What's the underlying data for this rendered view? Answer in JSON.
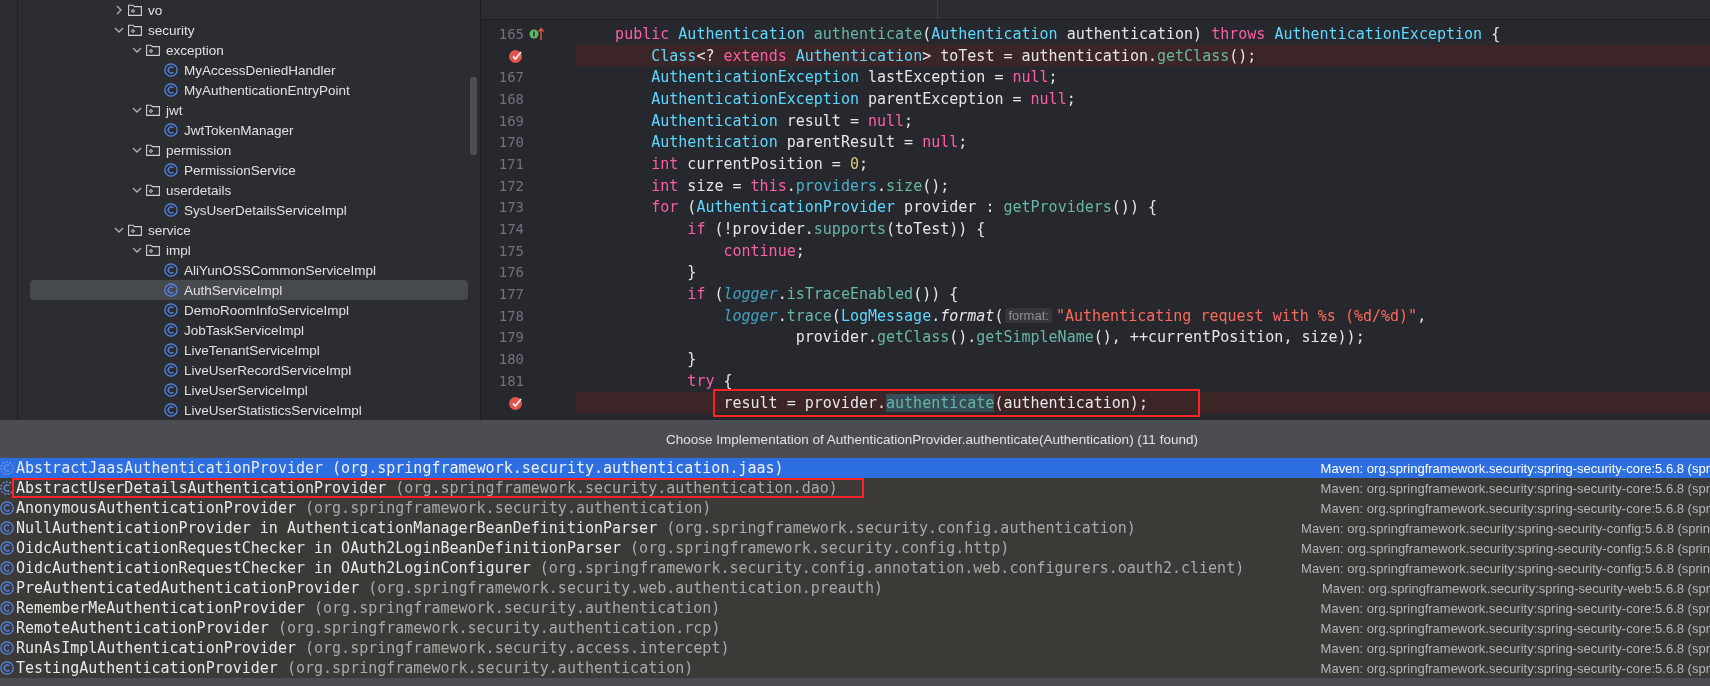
{
  "project_tree": {
    "items": [
      {
        "label": "vo",
        "kind": "folder",
        "expanded": false,
        "selected": false
      },
      {
        "label": "security",
        "kind": "folder",
        "expanded": true,
        "selected": false,
        "children": [
          {
            "label": "exception",
            "kind": "folder",
            "expanded": true,
            "selected": false,
            "children": [
              {
                "label": "MyAccessDeniedHandler",
                "kind": "class",
                "selected": false
              },
              {
                "label": "MyAuthenticationEntryPoint",
                "kind": "class",
                "selected": false
              }
            ]
          },
          {
            "label": "jwt",
            "kind": "folder",
            "expanded": true,
            "selected": false,
            "children": [
              {
                "label": "JwtTokenManager",
                "kind": "class",
                "selected": false
              }
            ]
          },
          {
            "label": "permission",
            "kind": "folder",
            "expanded": true,
            "selected": false,
            "children": [
              {
                "label": "PermissionService",
                "kind": "class",
                "selected": false
              }
            ]
          },
          {
            "label": "userdetails",
            "kind": "folder",
            "expanded": true,
            "selected": false,
            "children": [
              {
                "label": "SysUserDetailsServiceImpl",
                "kind": "class",
                "selected": false
              }
            ]
          }
        ]
      },
      {
        "label": "service",
        "kind": "folder",
        "expanded": true,
        "selected": false,
        "children": [
          {
            "label": "impl",
            "kind": "folder",
            "expanded": true,
            "selected": false,
            "children": [
              {
                "label": "AliYunOSSCommonServiceImpl",
                "kind": "class",
                "selected": false
              },
              {
                "label": "AuthServiceImpl",
                "kind": "class",
                "selected": true
              },
              {
                "label": "DemoRoomInfoServiceImpl",
                "kind": "class",
                "selected": false
              },
              {
                "label": "JobTaskServiceImpl",
                "kind": "class",
                "selected": false
              },
              {
                "label": "LiveTenantServiceImpl",
                "kind": "class",
                "selected": false
              },
              {
                "label": "LiveUserRecordServiceImpl",
                "kind": "class",
                "selected": false
              },
              {
                "label": "LiveUserServiceImpl",
                "kind": "class",
                "selected": false
              },
              {
                "label": "LiveUserStatisticsServiceImpl",
                "kind": "class",
                "selected": false
              }
            ]
          }
        ]
      }
    ]
  },
  "editor": {
    "lines": [
      {
        "number": "165",
        "override": true,
        "breakpoint": false,
        "annotated": false,
        "segments": [
          {
            "text": "    public ",
            "kind": "keyword"
          },
          {
            "text": "Authentication ",
            "kind": "type"
          },
          {
            "text": "authenticate",
            "kind": "function"
          },
          {
            "text": "(",
            "kind": "plain"
          },
          {
            "text": "Authentication",
            "kind": "type"
          },
          {
            "text": " authentication) ",
            "kind": "plain"
          },
          {
            "text": "throws ",
            "kind": "keyword"
          },
          {
            "text": "AuthenticationException",
            "kind": "type"
          },
          {
            "text": " {",
            "kind": "plain"
          }
        ]
      },
      {
        "override": false,
        "breakpoint": true,
        "annotated": false,
        "segments": [
          {
            "text": "        Class",
            "kind": "type"
          },
          {
            "text": "<? ",
            "kind": "plain"
          },
          {
            "text": "extends ",
            "kind": "keyword"
          },
          {
            "text": "Authentication",
            "kind": "type"
          },
          {
            "text": "> toTest = authentication.",
            "kind": "plain"
          },
          {
            "text": "getClass",
            "kind": "function"
          },
          {
            "text": "();",
            "kind": "plain"
          }
        ]
      },
      {
        "number": "167",
        "override": false,
        "breakpoint": false,
        "annotated": false,
        "segments": [
          {
            "text": "        AuthenticationException",
            "kind": "type"
          },
          {
            "text": " lastException = ",
            "kind": "plain"
          },
          {
            "text": "null",
            "kind": "keyword"
          },
          {
            "text": ";",
            "kind": "plain"
          }
        ]
      },
      {
        "number": "168",
        "override": false,
        "breakpoint": false,
        "annotated": false,
        "segments": [
          {
            "text": "        AuthenticationException",
            "kind": "type"
          },
          {
            "text": " parentException = ",
            "kind": "plain"
          },
          {
            "text": "null",
            "kind": "keyword"
          },
          {
            "text": ";",
            "kind": "plain"
          }
        ]
      },
      {
        "number": "169",
        "override": false,
        "breakpoint": false,
        "annotated": false,
        "segments": [
          {
            "text": "        Authentication",
            "kind": "type"
          },
          {
            "text": " result = ",
            "kind": "plain"
          },
          {
            "text": "null",
            "kind": "keyword"
          },
          {
            "text": ";",
            "kind": "plain"
          }
        ]
      },
      {
        "number": "170",
        "override": false,
        "breakpoint": false,
        "annotated": false,
        "segments": [
          {
            "text": "        Authentication",
            "kind": "type"
          },
          {
            "text": " parentResult = ",
            "kind": "plain"
          },
          {
            "text": "null",
            "kind": "keyword"
          },
          {
            "text": ";",
            "kind": "plain"
          }
        ]
      },
      {
        "number": "171",
        "override": false,
        "breakpoint": false,
        "annotated": false,
        "segments": [
          {
            "text": "        int",
            "kind": "keyword"
          },
          {
            "text": " currentPosition = ",
            "kind": "plain"
          },
          {
            "text": "0",
            "kind": "number"
          },
          {
            "text": ";",
            "kind": "plain"
          }
        ]
      },
      {
        "number": "172",
        "override": false,
        "breakpoint": false,
        "annotated": false,
        "segments": [
          {
            "text": "        int",
            "kind": "keyword"
          },
          {
            "text": " size = ",
            "kind": "plain"
          },
          {
            "text": "this",
            "kind": "keyword"
          },
          {
            "text": ".",
            "kind": "plain"
          },
          {
            "text": "providers",
            "kind": "field"
          },
          {
            "text": ".",
            "kind": "plain"
          },
          {
            "text": "size",
            "kind": "function"
          },
          {
            "text": "();",
            "kind": "plain"
          }
        ]
      },
      {
        "number": "173",
        "override": false,
        "breakpoint": false,
        "annotated": false,
        "segments": [
          {
            "text": "        for",
            "kind": "keyword"
          },
          {
            "text": " (",
            "kind": "plain"
          },
          {
            "text": "AuthenticationProvider",
            "kind": "type"
          },
          {
            "text": " provider : ",
            "kind": "plain"
          },
          {
            "text": "getProviders",
            "kind": "function"
          },
          {
            "text": "()) {",
            "kind": "plain"
          }
        ]
      },
      {
        "number": "174",
        "override": false,
        "breakpoint": false,
        "annotated": false,
        "segments": [
          {
            "text": "            if",
            "kind": "keyword"
          },
          {
            "text": " (!provider.",
            "kind": "plain"
          },
          {
            "text": "supports",
            "kind": "function"
          },
          {
            "text": "(toTest)) {",
            "kind": "plain"
          }
        ]
      },
      {
        "number": "175",
        "override": false,
        "breakpoint": false,
        "annotated": false,
        "segments": [
          {
            "text": "                continue",
            "kind": "keyword"
          },
          {
            "text": ";",
            "kind": "plain"
          }
        ]
      },
      {
        "number": "176",
        "override": false,
        "breakpoint": false,
        "annotated": false,
        "segments": [
          {
            "text": "            }",
            "kind": "plain"
          }
        ]
      },
      {
        "number": "177",
        "override": false,
        "breakpoint": false,
        "annotated": false,
        "segments": [
          {
            "text": "            if",
            "kind": "keyword"
          },
          {
            "text": " (",
            "kind": "plain"
          },
          {
            "text": "logger",
            "kind": "static"
          },
          {
            "text": ".",
            "kind": "plain"
          },
          {
            "text": "isTraceEnabled",
            "kind": "function"
          },
          {
            "text": "()) {",
            "kind": "plain"
          }
        ]
      },
      {
        "number": "178",
        "override": false,
        "breakpoint": false,
        "annotated": false,
        "segments": [
          {
            "text": "                logger",
            "kind": "static"
          },
          {
            "text": ".",
            "kind": "plain"
          },
          {
            "text": "trace",
            "kind": "function"
          },
          {
            "text": "(",
            "kind": "plain"
          },
          {
            "text": "LogMessage",
            "kind": "type"
          },
          {
            "text": ".",
            "kind": "plain"
          },
          {
            "text": "format",
            "kind": "italic"
          },
          {
            "text": "(",
            "kind": "plain"
          },
          {
            "text": "format:",
            "kind": "hint"
          },
          {
            "text": "\"Authenticating request with %s (%d/%d)\"",
            "kind": "string"
          },
          {
            "text": ",",
            "kind": "plain"
          }
        ]
      },
      {
        "number": "179",
        "override": false,
        "breakpoint": false,
        "annotated": false,
        "segments": [
          {
            "text": "                        provider.",
            "kind": "plain"
          },
          {
            "text": "getClass",
            "kind": "function"
          },
          {
            "text": "().",
            "kind": "plain"
          },
          {
            "text": "getSimpleName",
            "kind": "function"
          },
          {
            "text": "(), ++currentPosition, size));",
            "kind": "plain"
          }
        ]
      },
      {
        "number": "180",
        "override": false,
        "breakpoint": false,
        "annotated": false,
        "segments": [
          {
            "text": "            }",
            "kind": "plain"
          }
        ]
      },
      {
        "number": "181",
        "override": false,
        "breakpoint": false,
        "annotated": false,
        "segments": [
          {
            "text": "            try",
            "kind": "keyword"
          },
          {
            "text": " {",
            "kind": "plain"
          }
        ]
      },
      {
        "override": false,
        "breakpoint": true,
        "annotated": true,
        "segments": [
          {
            "text": "                result = provider.",
            "kind": "plain"
          },
          {
            "text": "authenticate",
            "kind": "selected"
          },
          {
            "text": "(authentication);",
            "kind": "plain"
          }
        ]
      }
    ]
  },
  "implementation_popup": {
    "title": "Choose Implementation of AuthenticationProvider.authenticate(Authentication) (11 found)",
    "items": [
      {
        "kind": "abstract",
        "name": "AbstractJaasAuthenticationProvider",
        "package": "(org.springframework.security.authentication.jaas)",
        "library": "Maven: org.springframework.security:spring-security-core:5.6.8 (spr",
        "selected": true,
        "annotated": false
      },
      {
        "kind": "abstract",
        "name": "AbstractUserDetailsAuthenticationProvider",
        "package": "(org.springframework.security.authentication.dao)",
        "library": "Maven: org.springframework.security:spring-security-core:5.6.8 (spr",
        "selected": false,
        "annotated": true
      },
      {
        "kind": "class",
        "name": "AnonymousAuthenticationProvider",
        "package": "(org.springframework.security.authentication)",
        "library": "Maven: org.springframework.security:spring-security-core:5.6.8 (spr",
        "selected": false,
        "annotated": false
      },
      {
        "kind": "class",
        "name": "NullAuthenticationProvider in AuthenticationManagerBeanDefinitionParser",
        "package": "(org.springframework.security.config.authentication)",
        "library": "Maven: org.springframework.security:spring-security-config:5.6.8 (sprin",
        "selected": false,
        "annotated": false
      },
      {
        "kind": "class",
        "name": "OidcAuthenticationRequestChecker in OAuth2LoginBeanDefinitionParser",
        "package": "(org.springframework.security.config.http)",
        "library": "Maven: org.springframework.security:spring-security-config:5.6.8 (sprin",
        "selected": false,
        "annotated": false
      },
      {
        "kind": "class",
        "name": "OidcAuthenticationRequestChecker in OAuth2LoginConfigurer",
        "package": "(org.springframework.security.config.annotation.web.configurers.oauth2.client)",
        "library": "Maven: org.springframework.security:spring-security-config:5.6.8 (sprin",
        "selected": false,
        "annotated": false
      },
      {
        "kind": "class",
        "name": "PreAuthenticatedAuthenticationProvider",
        "package": "(org.springframework.security.web.authentication.preauth)",
        "library": "Maven: org.springframework.security:spring-security-web:5.6.8 (spr",
        "selected": false,
        "annotated": false
      },
      {
        "kind": "class",
        "name": "RememberMeAuthenticationProvider",
        "package": "(org.springframework.security.authentication)",
        "library": "Maven: org.springframework.security:spring-security-core:5.6.8 (spr",
        "selected": false,
        "annotated": false
      },
      {
        "kind": "class",
        "name": "RemoteAuthenticationProvider",
        "package": "(org.springframework.security.authentication.rcp)",
        "library": "Maven: org.springframework.security:spring-security-core:5.6.8 (spr",
        "selected": false,
        "annotated": false
      },
      {
        "kind": "class",
        "name": "RunAsImplAuthenticationProvider",
        "package": "(org.springframework.security.access.intercept)",
        "library": "Maven: org.springframework.security:spring-security-core:5.6.8 (spr",
        "selected": false,
        "annotated": false
      },
      {
        "kind": "class",
        "name": "TestingAuthenticationProvider",
        "package": "(org.springframework.security.authentication)",
        "library": "Maven: org.springframework.security:spring-security-core:5.6.8 (spr",
        "selected": false,
        "annotated": false
      }
    ]
  }
}
